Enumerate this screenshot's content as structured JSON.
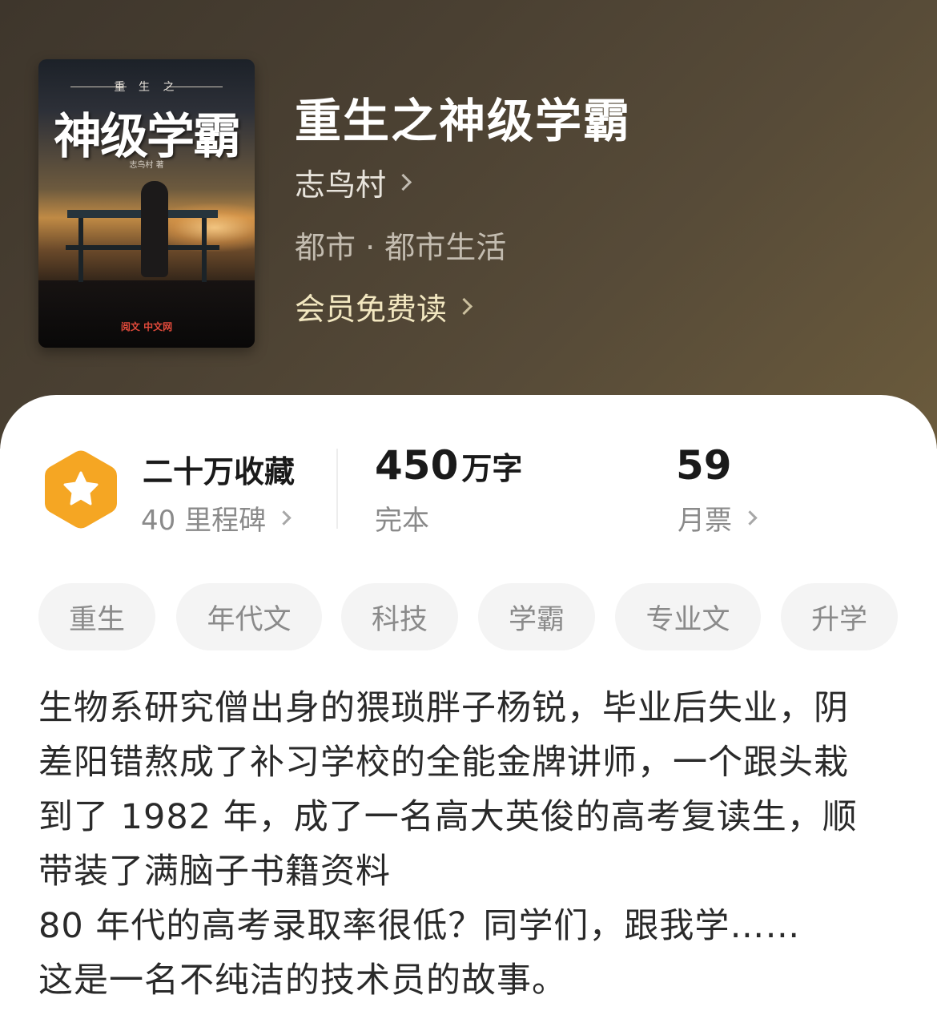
{
  "book": {
    "title": "重生之神级学霸",
    "author": "志鸟村",
    "genre": "都市 · 都市生活",
    "vip_label": "会员免费读"
  },
  "cover": {
    "subtitle": "重 生 之",
    "title": "神级学霸",
    "author_line": "志鸟村 著",
    "publisher_logo": "阅文 中文网"
  },
  "stats": {
    "collection": {
      "title": "二十万收藏",
      "sub": "40 里程碑"
    },
    "words": {
      "number": "450",
      "unit": "万字",
      "sub": "完本"
    },
    "monthly": {
      "number": "59",
      "sub": "月票"
    }
  },
  "tags": [
    "重生",
    "年代文",
    "科技",
    "学霸",
    "专业文",
    "升学"
  ],
  "description": [
    "生物系研究僧出身的猥琐胖子杨锐，毕业后失业，阴",
    "差阳错熬成了补习学校的全能金牌讲师，一个跟头栽",
    "到了 1982 年，成了一名高大英俊的高考复读生，顺",
    "带装了满脑子书籍资料",
    "80 年代的高考录取率很低？同学们，跟我学……",
    "这是一名不纯洁的技术员的故事。"
  ],
  "colors": {
    "hero_bg": "#4a4032",
    "badge": "#f5a623",
    "vip_text": "#f2e7c0"
  },
  "icons": {
    "badge": "star-hexagon-icon",
    "chevron": "chevron-right-icon"
  }
}
